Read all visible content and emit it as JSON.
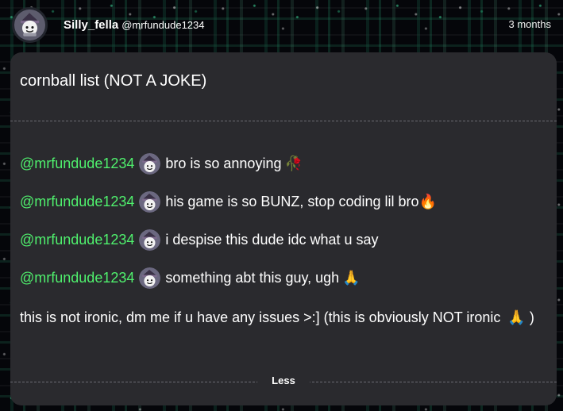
{
  "post": {
    "author": {
      "username": "Silly_fella",
      "handle": "@mrfundude1234"
    },
    "time": "3 months",
    "title": "cornball list (NOT A JOKE)",
    "items": [
      {
        "mention": "@mrfundude1234",
        "text": "bro is so annoying",
        "emoji": "🥀",
        "emoji_name": "wilted-flower-icon"
      },
      {
        "mention": "@mrfundude1234",
        "text": "his game is so BUNZ, stop coding lil bro",
        "emoji": "🔥",
        "emoji_name": "fire-icon"
      },
      {
        "mention": "@mrfundude1234",
        "text": "i despise this dude idc what u say",
        "emoji": "",
        "emoji_name": ""
      },
      {
        "mention": "@mrfundude1234",
        "text": "something abt this guy, ugh",
        "emoji": "🙏",
        "emoji_name": "folded-hands-icon"
      }
    ],
    "paragraph_text_1": "this is not ironic, dm me if u have any issues >:] (this is obviously NOT ironic",
    "paragraph_emoji": "🙏",
    "paragraph_text_2": ")",
    "toggle_label": "Less"
  },
  "colors": {
    "mention": "#4ff06d",
    "card_background": "#2a2a2e",
    "page_background": "#05060a"
  }
}
